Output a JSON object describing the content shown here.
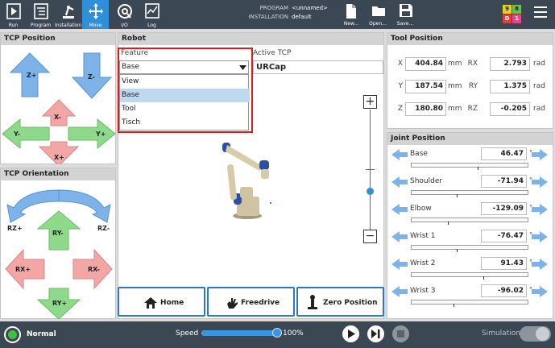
{
  "topbar": {
    "nav": [
      {
        "label": "Run",
        "icon": "run-icon"
      },
      {
        "label": "Program",
        "icon": "program-icon"
      },
      {
        "label": "Installation",
        "icon": "installation-icon"
      },
      {
        "label": "Move",
        "icon": "move-icon",
        "active": true
      },
      {
        "label": "I/O",
        "icon": "io-icon"
      },
      {
        "label": "Log",
        "icon": "log-icon"
      }
    ],
    "program_key": "PROGRAM",
    "program_value": "<unnamed>",
    "installation_key": "INSTALLATION",
    "installation_value": "default",
    "file_buttons": [
      {
        "label": "New...",
        "icon": "new-file-icon"
      },
      {
        "label": "Open...",
        "icon": "open-folder-icon"
      },
      {
        "label": "Save...",
        "icon": "save-icon"
      }
    ],
    "badges": {
      "top_left": "9",
      "top_right": "8",
      "bottom_left": "D",
      "bottom_right": "1"
    },
    "badge_colors": {
      "top_left": "#e2d21a",
      "top_right": "#6cc04a",
      "bottom_left": "#e23c3c",
      "bottom_right": "#e8458b"
    }
  },
  "tcp_position": {
    "title": "TCP Position",
    "arrows": {
      "z_plus": "Z+",
      "z_minus": "Z-",
      "x_minus": "X-",
      "y_minus": "Y-",
      "y_plus": "Y+",
      "x_plus": "X+"
    }
  },
  "tcp_orientation": {
    "title": "TCP Orientation",
    "arrows": {
      "rz_plus": "RZ+",
      "rz_minus": "RZ-",
      "ry_minus": "RY-",
      "rx_plus": "RX+",
      "rx_minus": "RX-",
      "ry_plus": "RY+"
    }
  },
  "robot": {
    "title": "Robot",
    "feature_label": "Feature",
    "feature_selected": "Base",
    "feature_options": [
      "View",
      "Base",
      "Tool",
      "Tisch"
    ],
    "active_tcp_label": "Active TCP",
    "active_tcp_value": "URCap",
    "zoom_in": "+",
    "zoom_out": "−",
    "buttons": {
      "home": "Home",
      "freedrive": "Freedrive",
      "zero_position": "Zero Position"
    }
  },
  "tool_position": {
    "title": "Tool Position",
    "rows": [
      {
        "label": "X",
        "value": "404.84",
        "unit": "mm",
        "rlabel": "RX",
        "rvalue": "2.793",
        "runit": "rad"
      },
      {
        "label": "Y",
        "value": "187.54",
        "unit": "mm",
        "rlabel": "RY",
        "rvalue": "1.375",
        "runit": "rad"
      },
      {
        "label": "Z",
        "value": "180.80",
        "unit": "mm",
        "rlabel": "RZ",
        "rvalue": "-0.205",
        "runit": "rad"
      }
    ]
  },
  "joint_position": {
    "title": "Joint Position",
    "unit": "°",
    "joints": [
      {
        "name": "Base",
        "value": "46.47",
        "level": 0.57
      },
      {
        "name": "Shoulder",
        "value": "-71.94",
        "level": 0.39
      },
      {
        "name": "Elbow",
        "value": "-129.09",
        "level": 0.31
      },
      {
        "name": "Wrist 1",
        "value": "-76.47",
        "level": 0.39
      },
      {
        "name": "Wrist 2",
        "value": "91.43",
        "level": 0.62
      },
      {
        "name": "Wrist 3",
        "value": "-96.02",
        "level": 0.36
      }
    ]
  },
  "footer": {
    "status": "Normal",
    "speed_label": "Speed",
    "speed_value": "100%",
    "speed_level": 1.0,
    "simulation_label": "Simulation"
  }
}
